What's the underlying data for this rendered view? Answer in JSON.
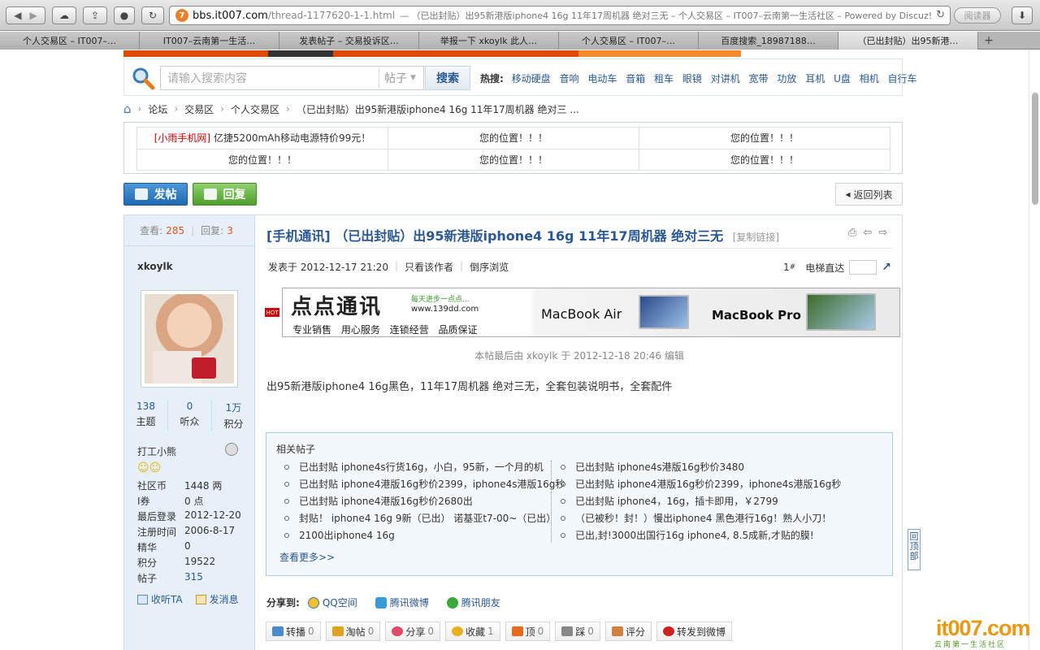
{
  "browser": {
    "url_host": "bbs.it007.com",
    "url_path": "/thread-1177620-1-1.html",
    "url_title": "— （已出封贴）出95新港版iphone4 16g 11年17周机器 绝对三无 – 个人交易区 – IT007–云南第一生活社区 – Powered by Discuz!",
    "reader_label": "阅读器",
    "tabs": [
      {
        "label": "个人交易区 – IT007–…"
      },
      {
        "label": "IT007–云南第一生活…"
      },
      {
        "label": "发表帖子 – 交易投诉区…"
      },
      {
        "label": "举报一下 xkoylk 此人…"
      },
      {
        "label": "个人交易区 – IT007–…"
      },
      {
        "label": "百度搜索_18987188…"
      },
      {
        "label": "（已出封贴）出95新港…"
      }
    ],
    "tab_add": "+"
  },
  "search": {
    "placeholder": "请输入搜索内容",
    "type": "帖子",
    "button": "搜索",
    "hot_label": "热搜:",
    "hot_items": [
      "移动硬盘",
      "音响",
      "电动车",
      "音箱",
      "租车",
      "眼镜",
      "对讲机",
      "宽带",
      "功放",
      "耳机",
      "U盘",
      "相机",
      "自行车"
    ]
  },
  "breadcrumb": [
    "论坛",
    "交易区",
    "个人交易区",
    "（已出封贴）出95新港版iphone4 16g 11年17周机器 绝对三 ..."
  ],
  "ads": {
    "row1": [
      {
        "tag": "[小雨手机网]",
        "text": " 亿捷5200mAh移动电源特价99元！"
      },
      {
        "text": "您的位置！！！"
      },
      {
        "text": "您的位置！！！"
      }
    ],
    "row2": [
      {
        "text": "您的位置！！！"
      },
      {
        "text": "您的位置！！！"
      },
      {
        "text": "您的位置！！！"
      }
    ]
  },
  "buttons": {
    "post": "发帖",
    "reply": "回复",
    "back_list": "返回列表"
  },
  "user": {
    "views_label": "查看:",
    "views": "285",
    "replies_label": "回复:",
    "replies": "3",
    "name": "xkoylk",
    "stats": [
      {
        "n": "138",
        "l": "主题"
      },
      {
        "n": "0",
        "l": "听众"
      },
      {
        "n": "1万",
        "l": "积分"
      }
    ],
    "group": "打工小熊",
    "smileys": "☺☺",
    "fields": [
      {
        "k": "社区币",
        "v": "1448 两"
      },
      {
        "k": "I券",
        "v": "0 点"
      },
      {
        "k": "最后登录",
        "v": "2012-12-20"
      },
      {
        "k": "注册时间",
        "v": "2006-8-17"
      },
      {
        "k": "精华",
        "v": "0"
      },
      {
        "k": "积分",
        "v": "19522"
      },
      {
        "k": "帖子",
        "v": "315"
      }
    ],
    "follow": "收听TA",
    "message": "发消息"
  },
  "post": {
    "category": "[手机通讯]",
    "title": " （已出封贴）出95新港版iphone4 16g 11年17周机器 绝对三无",
    "copy_link": "[复制链接]",
    "posted_at": "发表于 2012-12-17 21:20",
    "only_author": "只看该作者",
    "reverse": "倒序浏览",
    "floor_num": "1",
    "floor_mark": "#",
    "elevator": "电梯直达",
    "edit_note": "本帖最后由 xkoylk 于 2012-12-18 20:46 编辑",
    "body": "出95新港版iphone4 16g黑色，11年17周机器 绝对三无，全套包装说明书，全套配件"
  },
  "adbanner": {
    "hot": "HOT",
    "logo": "点点通讯",
    "slogan": "每天进步一点点...",
    "url": "www.139dd.com",
    "tagline": "专业销售 用心服务 连锁经营 品质保证",
    "mba": "MacBook Air",
    "mbp": "MacBook Pro"
  },
  "related": {
    "title": "相关帖子",
    "left": [
      "已出封贴 iphone4s行货16g，小白，95新，一个月的机",
      "已出封贴 iphone4港版16g秒价2399，iphone4s港版16g秒",
      "已出封贴 iphone4港版16g秒价2680出",
      "封贴！ iphone4 16g 9新（已出） 诺基亚t7-00~（已出）",
      "2100出iphone4 16g"
    ],
    "right": [
      "已出封贴 iphone4s港版16g秒价3480",
      "已出封贴 iphone4港版16g秒价2399，iphone4s港版16g秒",
      "已出封贴 iphone4，16g，插卡即用，￥2799",
      "（已被秒！封！）慢出iphone4 黑色港行16g！熟人小刀！",
      "已出,封!3000出国行16g iphone4, 8.5成新,才贴的膜!"
    ],
    "more": "查看更多>>"
  },
  "share": {
    "label": "分享到:",
    "items": [
      "QQ空间",
      "腾讯微博",
      "腾讯朋友"
    ]
  },
  "actions": [
    {
      "label": "转播",
      "count": "0",
      "color": "#4a8ad0"
    },
    {
      "label": "淘帖",
      "count": "0",
      "color": "#e0a020"
    },
    {
      "label": "分享",
      "count": "0",
      "color": "#e04a6a"
    },
    {
      "label": "收藏",
      "count": "1",
      "color": "#e8b020"
    },
    {
      "label": "顶",
      "count": "0",
      "color": "#e86a20"
    },
    {
      "label": "踩",
      "count": "0",
      "color": "#888888"
    },
    {
      "label": "评分",
      "count": "",
      "color": "#d08040"
    },
    {
      "label": "转发到微博",
      "count": "",
      "color": "#d02020"
    }
  ],
  "back_top": "回顶部",
  "watermark": {
    "logo": "it007.com",
    "sub": "云南第一生活社区"
  }
}
